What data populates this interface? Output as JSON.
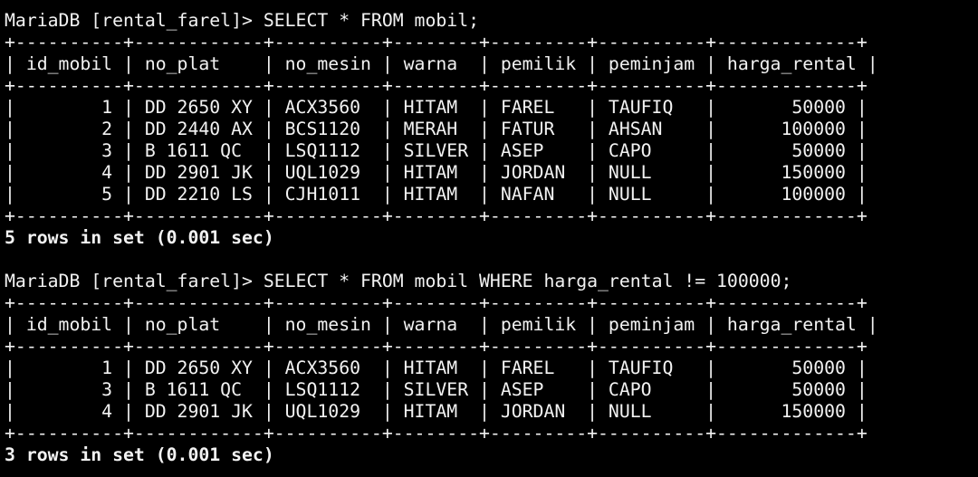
{
  "colors": {
    "background": "#000000",
    "text": "#f2f2f2"
  },
  "session": {
    "prompt": "MariaDB [rental_farel]> ",
    "border": "+----------+------------+----------+--------+---------+----------+-------------+",
    "columns": [
      "id_mobil",
      "no_plat",
      "no_mesin",
      "warna",
      "pemilik",
      "peminjam",
      "harga_rental"
    ],
    "queries": [
      {
        "command": "SELECT * FROM mobil;",
        "rows": [
          [
            "1",
            "DD 2650 XY",
            "ACX3560",
            "HITAM",
            "FAREL",
            "TAUFIQ",
            "50000"
          ],
          [
            "2",
            "DD 2440 AX",
            "BCS1120",
            "MERAH",
            "FATUR",
            "AHSAN",
            "100000"
          ],
          [
            "3",
            "B 1611 QC",
            "LSQ1112",
            "SILVER",
            "ASEP",
            "CAPO",
            "50000"
          ],
          [
            "4",
            "DD 2901 JK",
            "UQL1029",
            "HITAM",
            "JORDAN",
            "NULL",
            "150000"
          ],
          [
            "5",
            "DD 2210 LS",
            "CJH1011",
            "HITAM",
            "NAFAN",
            "NULL",
            "100000"
          ]
        ],
        "summary": "5 rows in set (0.001 sec)"
      },
      {
        "command": "SELECT * FROM mobil WHERE harga_rental != 100000;",
        "rows": [
          [
            "1",
            "DD 2650 XY",
            "ACX3560",
            "HITAM",
            "FAREL",
            "TAUFIQ",
            "50000"
          ],
          [
            "3",
            "B 1611 QC",
            "LSQ1112",
            "SILVER",
            "ASEP",
            "CAPO",
            "50000"
          ],
          [
            "4",
            "DD 2901 JK",
            "UQL1029",
            "HITAM",
            "JORDAN",
            "NULL",
            "150000"
          ]
        ],
        "summary": "3 rows in set (0.001 sec)"
      }
    ]
  }
}
